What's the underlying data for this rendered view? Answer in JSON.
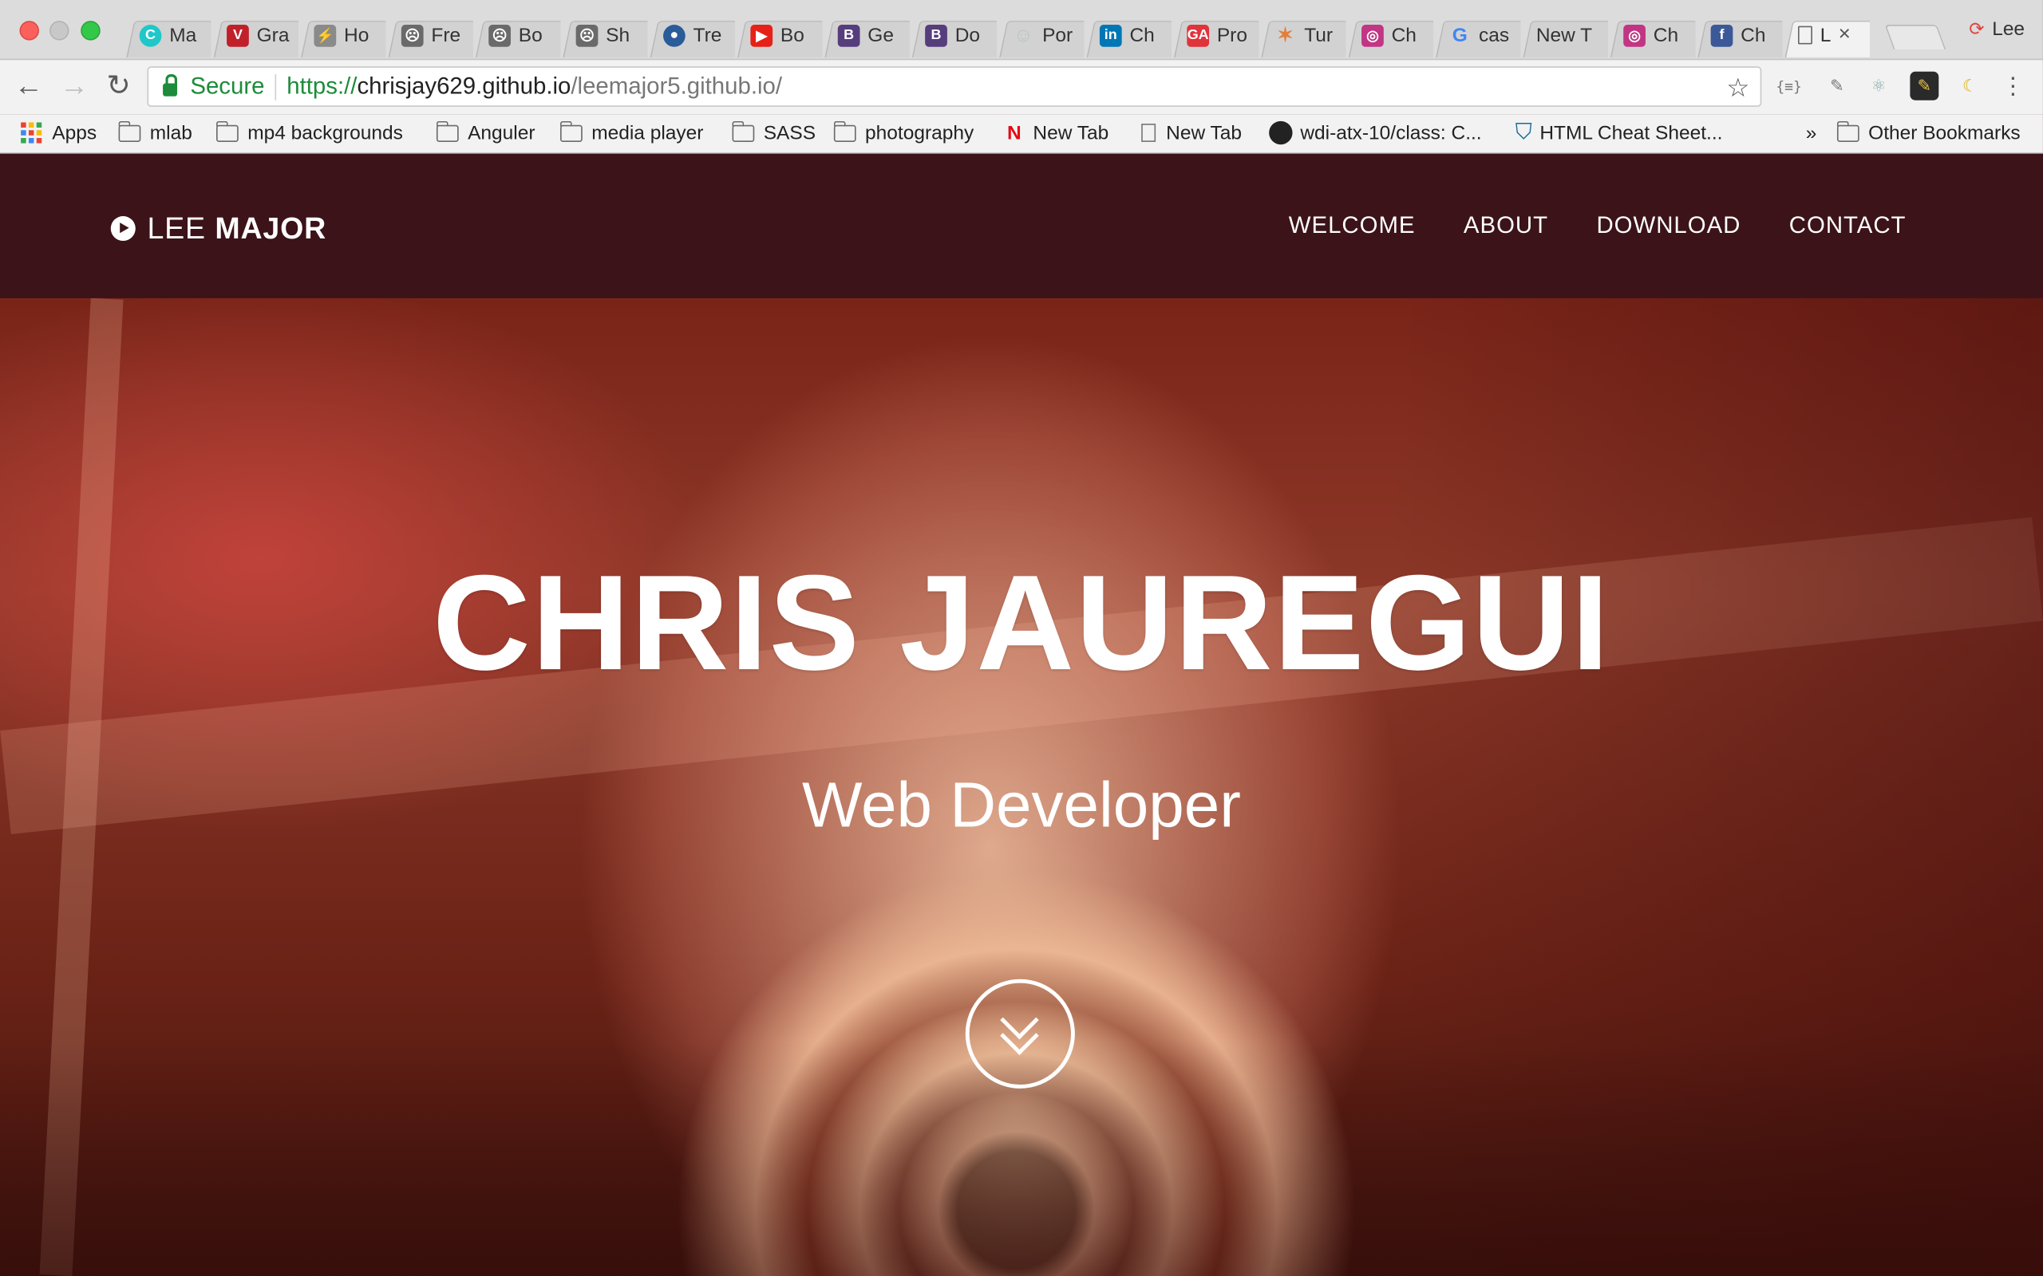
{
  "browser": {
    "tabs": [
      {
        "label": "Ma",
        "icon": "c-circle-icon",
        "color": "#1fc7c9",
        "glyph": "C"
      },
      {
        "label": "Gra",
        "icon": "vf-logo-icon",
        "color": "#c0202a",
        "glyph": "V"
      },
      {
        "label": "Ho",
        "icon": "lightning-icon",
        "color": "#8a8a8a",
        "glyph": "⚡"
      },
      {
        "label": "Fre",
        "icon": "sad-page-icon",
        "color": "#6a6a6a",
        "glyph": "☹"
      },
      {
        "label": "Bo",
        "icon": "sad-page-icon",
        "color": "#6a6a6a",
        "glyph": "☹"
      },
      {
        "label": "Sh",
        "icon": "sad-page-icon",
        "color": "#6a6a6a",
        "glyph": "☹"
      },
      {
        "label": "Tre",
        "icon": "globe-icon",
        "color": "#2a5c9a",
        "glyph": "●"
      },
      {
        "label": "Bo",
        "icon": "youtube-icon",
        "color": "#e62117",
        "glyph": "▶"
      },
      {
        "label": "Ge",
        "icon": "bootstrap-icon",
        "color": "#563d7c",
        "glyph": "B"
      },
      {
        "label": "Do",
        "icon": "bootstrap-icon",
        "color": "#563d7c",
        "glyph": "B"
      },
      {
        "label": "Por",
        "icon": "avatar-icon",
        "color": "#b8c4c8",
        "glyph": "☺"
      },
      {
        "label": "Ch",
        "icon": "linkedin-icon",
        "color": "#0077b5",
        "glyph": "in"
      },
      {
        "label": "Pro",
        "icon": "ga-icon",
        "color": "#e0333b",
        "glyph": "GA"
      },
      {
        "label": "Tur",
        "icon": "pinwheel-icon",
        "color": "#e2803a",
        "glyph": "✶"
      },
      {
        "label": "Ch",
        "icon": "instagram-icon",
        "color": "#c13584",
        "glyph": "◎"
      },
      {
        "label": "cas",
        "icon": "google-icon",
        "color": "#4285f4",
        "glyph": "G"
      },
      {
        "label": "New T",
        "icon": "none",
        "color": "#d2d2d2",
        "glyph": ""
      },
      {
        "label": "Ch",
        "icon": "instagram-icon",
        "color": "#c13584",
        "glyph": "◎"
      },
      {
        "label": "Ch",
        "icon": "facebook-icon",
        "color": "#3b5998",
        "glyph": "f"
      },
      {
        "label": "L",
        "icon": "page-icon",
        "color": "#ffffff",
        "glyph": "",
        "active": true
      }
    ],
    "profile_name": "Lee",
    "omnibox": {
      "secure_label": "Secure",
      "url_scheme": "https://",
      "url_host": "chrisjay629.github.io",
      "url_path": "/leemajor5.github.io/"
    },
    "bookmarks": [
      {
        "label": "Apps",
        "type": "apps"
      },
      {
        "label": "mlab",
        "type": "folder"
      },
      {
        "label": "mp4 backgrounds",
        "type": "folder"
      },
      {
        "label": "Anguler",
        "type": "folder"
      },
      {
        "label": "media player",
        "type": "folder"
      },
      {
        "label": "SASS",
        "type": "folder"
      },
      {
        "label": "photography",
        "type": "folder"
      },
      {
        "label": "New Tab",
        "type": "netflix"
      },
      {
        "label": "New Tab",
        "type": "page"
      },
      {
        "label": "wdi-atx-10/class: C...",
        "type": "github"
      },
      {
        "label": "HTML Cheat Sheet...",
        "type": "shield"
      },
      {
        "label": "»",
        "type": "overflow"
      },
      {
        "label": "Other Bookmarks",
        "type": "folder"
      }
    ]
  },
  "site": {
    "brand_light": "LEE",
    "brand_bold": "MAJOR",
    "nav": [
      "WELCOME",
      "ABOUT",
      "DOWNLOAD",
      "CONTACT"
    ],
    "hero_title": "CHRIS JAUREGUI",
    "hero_subtitle": "Web Developer"
  },
  "colors": {
    "navbar_bg": "#3b1318",
    "secure_green": "#1c8c3a"
  }
}
